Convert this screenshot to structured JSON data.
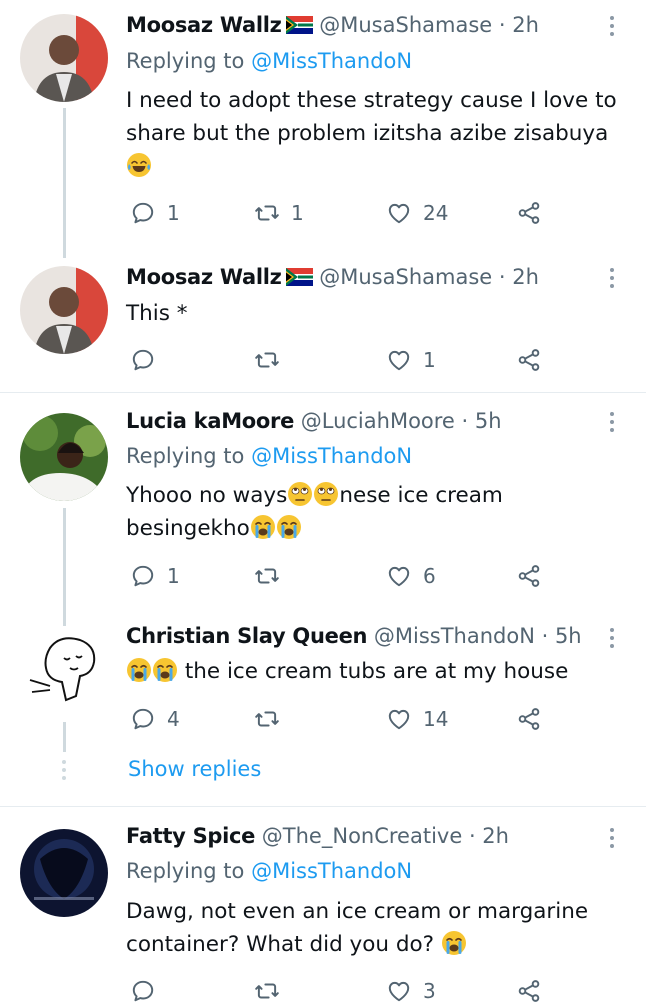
{
  "tweets": [
    {
      "name": "Moosaz Wallz",
      "handle": "@MusaShamase",
      "time": "· 2h",
      "reply_prefix": "Replying to ",
      "reply_user": "@MissThandoN",
      "text": "I need to adopt these strategy cause I love to share but the problem izitsha azibe zisabuya",
      "emoji_after": "laughing-tears",
      "replies": "1",
      "retweets": "1",
      "likes": "24"
    },
    {
      "name": "Moosaz Wallz",
      "handle": "@MusaShamase",
      "time": "· 2h",
      "text": "This *",
      "replies": "",
      "retweets": "",
      "likes": "1"
    },
    {
      "name": "Lucia kaMoore",
      "handle": "@LuciahMoore",
      "time": "· 5h",
      "reply_prefix": "Replying to ",
      "reply_user": "@MissThandoN",
      "text_a": "Yhooo no ways",
      "text_b": "nese ice cream",
      "text_c": "besingekho",
      "replies": "1",
      "retweets": "",
      "likes": "6"
    },
    {
      "name": "Christian Slay Queen",
      "handle": "@MissThandoN",
      "time": "· 5h",
      "text": "the ice cream tubs are at my house",
      "replies": "4",
      "retweets": "",
      "likes": "14"
    },
    {
      "name": "Fatty Spice",
      "handle": "@The_NonCreative",
      "time": "· 2h",
      "reply_prefix": "Replying to ",
      "reply_user": "@MissThandoN",
      "text": "Dawg, not even an ice cream or margarine container? What did you do?",
      "replies": "",
      "retweets": "",
      "likes": "3"
    }
  ],
  "show_replies": "Show replies",
  "colors": {
    "link": "#1d9bf0",
    "muted": "#536471",
    "text": "#0f1419",
    "divider": "#e6ecf0",
    "thread": "#cfd9de"
  }
}
